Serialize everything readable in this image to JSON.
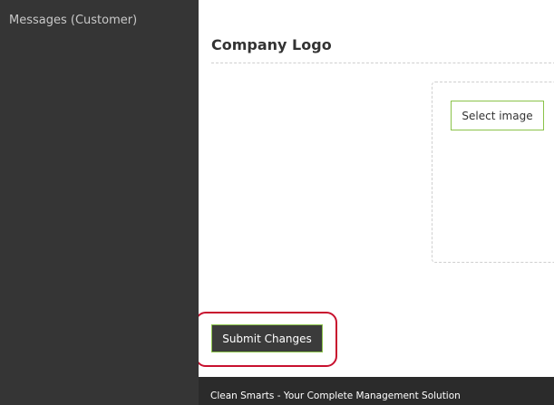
{
  "sidebar": {
    "items": [
      {
        "label": "Messages (Customer)"
      }
    ]
  },
  "main": {
    "section_title": "Company Logo",
    "logo_upload": {
      "select_label": "Select image"
    },
    "submit_label": "Submit Changes"
  },
  "footer": {
    "text": "Clean Smarts - Your Complete Management Solution"
  },
  "colors": {
    "sidebar_bg": "#353535",
    "accent_green": "#8bc34a",
    "button_dark": "#3b3b3b",
    "highlight_red": "#c8102e",
    "footer_bg": "#2b2b2b"
  }
}
